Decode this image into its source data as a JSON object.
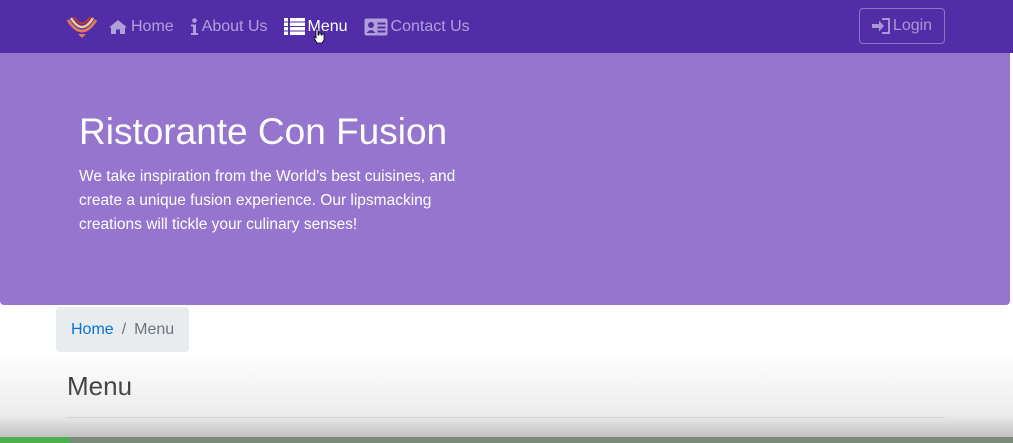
{
  "navbar": {
    "logo_alt": "Ristorante Con Fusion logo",
    "items": [
      {
        "label": "Home",
        "icon": "home-icon",
        "active": false
      },
      {
        "label": "About Us",
        "icon": "info-icon",
        "active": false
      },
      {
        "label": "Menu",
        "icon": "list-icon",
        "active": true
      },
      {
        "label": "Contact Us",
        "icon": "address-card-icon",
        "active": false
      }
    ],
    "login_label": "Login",
    "colors": {
      "background": "#512da8"
    }
  },
  "jumbotron": {
    "title": "Ristorante Con Fusion",
    "description": "We take inspiration from the World's best cuisines, and create a unique fusion experience. Our lipsmacking creations will tickle your culinary senses!",
    "colors": {
      "background": "#9575cd"
    }
  },
  "breadcrumb": {
    "items": [
      {
        "label": "Home",
        "link": true
      },
      {
        "label": "Menu",
        "link": false
      }
    ],
    "separator": "/"
  },
  "main": {
    "heading": "Menu"
  }
}
